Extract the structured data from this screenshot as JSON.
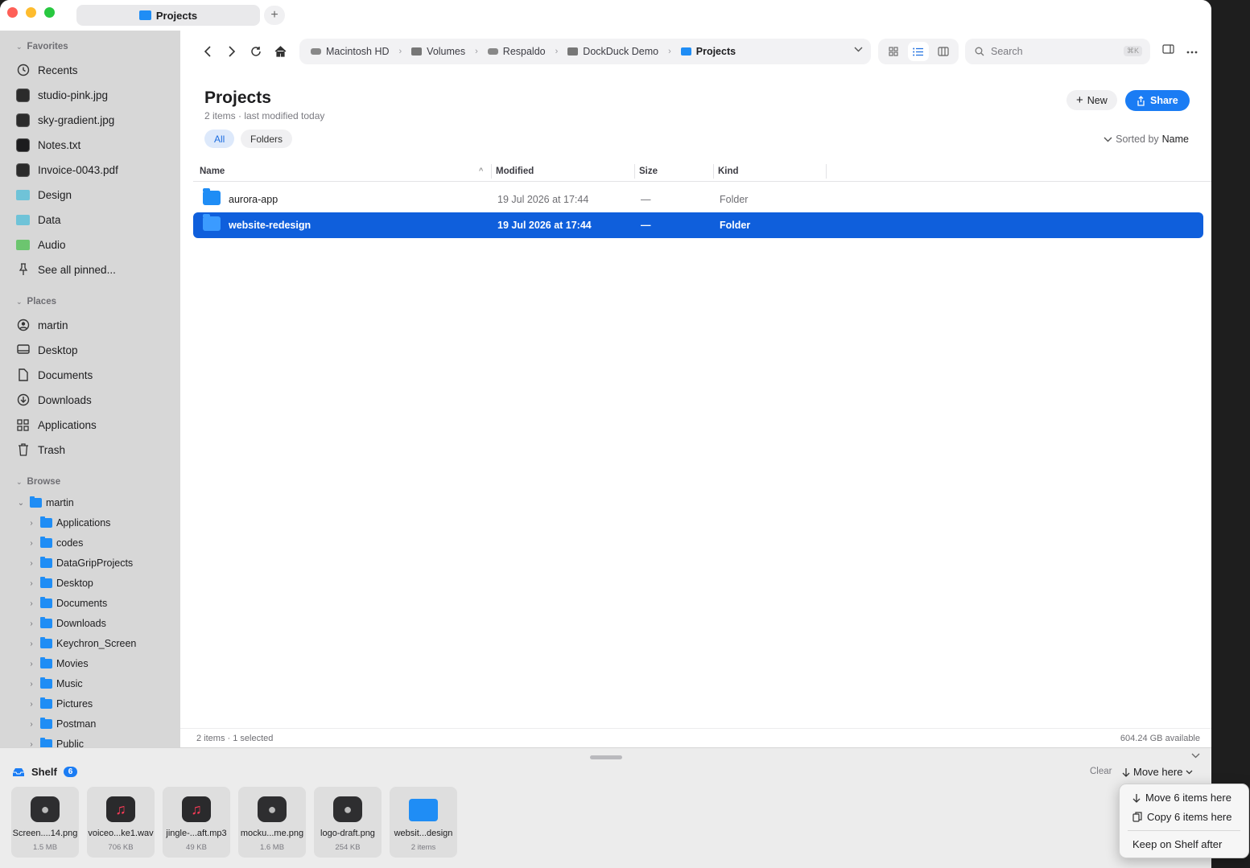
{
  "tab": {
    "title": "Projects",
    "add": "+"
  },
  "sidebar": {
    "favorites_header": "Favorites",
    "favorites": [
      {
        "label": "Recents",
        "icon": "clock-icon"
      },
      {
        "label": "studio-pink.jpg",
        "icon": "image-thumb-icon"
      },
      {
        "label": "sky-gradient.jpg",
        "icon": "image-thumb-icon"
      },
      {
        "label": "Notes.txt",
        "icon": "text-thumb-icon"
      },
      {
        "label": "Invoice-0043.pdf",
        "icon": "pdf-thumb-icon"
      },
      {
        "label": "Design",
        "icon": "folder-icon"
      },
      {
        "label": "Data",
        "icon": "folder-icon"
      },
      {
        "label": "Audio",
        "icon": "folder-icon"
      },
      {
        "label": "See all pinned...",
        "icon": "pin-icon"
      }
    ],
    "places_header": "Places",
    "places": [
      {
        "label": "martin",
        "icon": "user-icon"
      },
      {
        "label": "Desktop",
        "icon": "desktop-icon"
      },
      {
        "label": "Documents",
        "icon": "document-icon"
      },
      {
        "label": "Downloads",
        "icon": "download-icon"
      },
      {
        "label": "Applications",
        "icon": "grid-icon"
      },
      {
        "label": "Trash",
        "icon": "trash-icon"
      }
    ],
    "browse_header": "Browse",
    "browse_root": "martin",
    "browse": [
      "Applications",
      "codes",
      "DataGripProjects",
      "Desktop",
      "Documents",
      "Downloads",
      "Keychron_Screen",
      "Movies",
      "Music",
      "Pictures",
      "Postman",
      "Public"
    ]
  },
  "toolbar": {
    "breadcrumbs": [
      "Macintosh HD",
      "Volumes",
      "Respaldo",
      "DockDuck Demo",
      "Projects"
    ],
    "search_placeholder": "Search",
    "search_shortcut": "⌘K"
  },
  "content": {
    "title": "Projects",
    "subtitle": "2 items · last modified today",
    "filters": [
      "All",
      "Folders"
    ],
    "new_label": "New",
    "share_label": "Share",
    "sorted_prefix": "Sorted by",
    "sorted_value": "Name",
    "columns": [
      "Name",
      "Modified",
      "Size",
      "Kind"
    ],
    "rows": [
      {
        "name": "aurora-app",
        "modified": "19 Jul 2026 at 17:44",
        "size": "—",
        "kind": "Folder",
        "selected": false
      },
      {
        "name": "website-redesign",
        "modified": "19 Jul 2026 at 17:44",
        "size": "—",
        "kind": "Folder",
        "selected": true
      }
    ]
  },
  "status": {
    "left": "2 items · 1 selected",
    "right": "604.24 GB available"
  },
  "shelf": {
    "title": "Shelf",
    "count": "6",
    "clear": "Clear",
    "move_here": "Move here",
    "items": [
      {
        "name": "Screen....14.png",
        "size": "1.5 MB",
        "icon": "disk-image-icon"
      },
      {
        "name": "voiceo...ke1.wav",
        "size": "706 KB",
        "icon": "music-icon"
      },
      {
        "name": "jingle-...aft.mp3",
        "size": "49 KB",
        "icon": "music-icon"
      },
      {
        "name": "mocku...me.png",
        "size": "1.6 MB",
        "icon": "disk-image-icon"
      },
      {
        "name": "logo-draft.png",
        "size": "254 KB",
        "icon": "disk-image-icon"
      },
      {
        "name": "websit...design",
        "size": "2 items",
        "icon": "folder-icon"
      }
    ]
  },
  "popup": {
    "move": "Move 6 items here",
    "copy": "Copy 6 items here",
    "keep": "Keep on Shelf after"
  },
  "colors": {
    "accent": "#1a7cf4",
    "selection": "#0f5fdc",
    "sidebar_bg": "#d7d7d7"
  }
}
